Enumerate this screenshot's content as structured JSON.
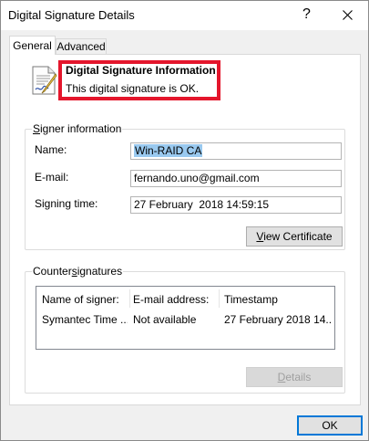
{
  "window": {
    "title": "Digital Signature Details",
    "help_glyph": "?",
    "close_glyph": "✕"
  },
  "tabs": [
    {
      "label": "General"
    },
    {
      "label": "Advanced"
    }
  ],
  "header": {
    "title": "Digital Signature Information",
    "status": "This digital signature is OK."
  },
  "signer": {
    "legend_mnemonic": "S",
    "legend_rest": "igner information",
    "name_label": "Name:",
    "name_value": "Win-RAID CA",
    "email_label": "E-mail:",
    "email_value": "fernando.uno@gmail.com",
    "time_label": "Signing time:",
    "time_value": "27 February  2018 14:59:15",
    "view_cert_mnemonic": "V",
    "view_cert_rest": "iew Certificate"
  },
  "countersignatures": {
    "legend_before": "Counter",
    "legend_mnemonic": "s",
    "legend_after": "ignatures",
    "columns": [
      "Name of signer:",
      "E-mail address:",
      "Timestamp"
    ],
    "rows": [
      [
        "Symantec Time ...",
        "Not available",
        "27 February 2018 14..."
      ]
    ],
    "details_mnemonic": "D",
    "details_rest": "etails"
  },
  "footer": {
    "ok_label": "OK"
  },
  "colors": {
    "highlight": "#e4162c",
    "selection": "#99c9ef",
    "default_button_border": "#0078d7"
  }
}
